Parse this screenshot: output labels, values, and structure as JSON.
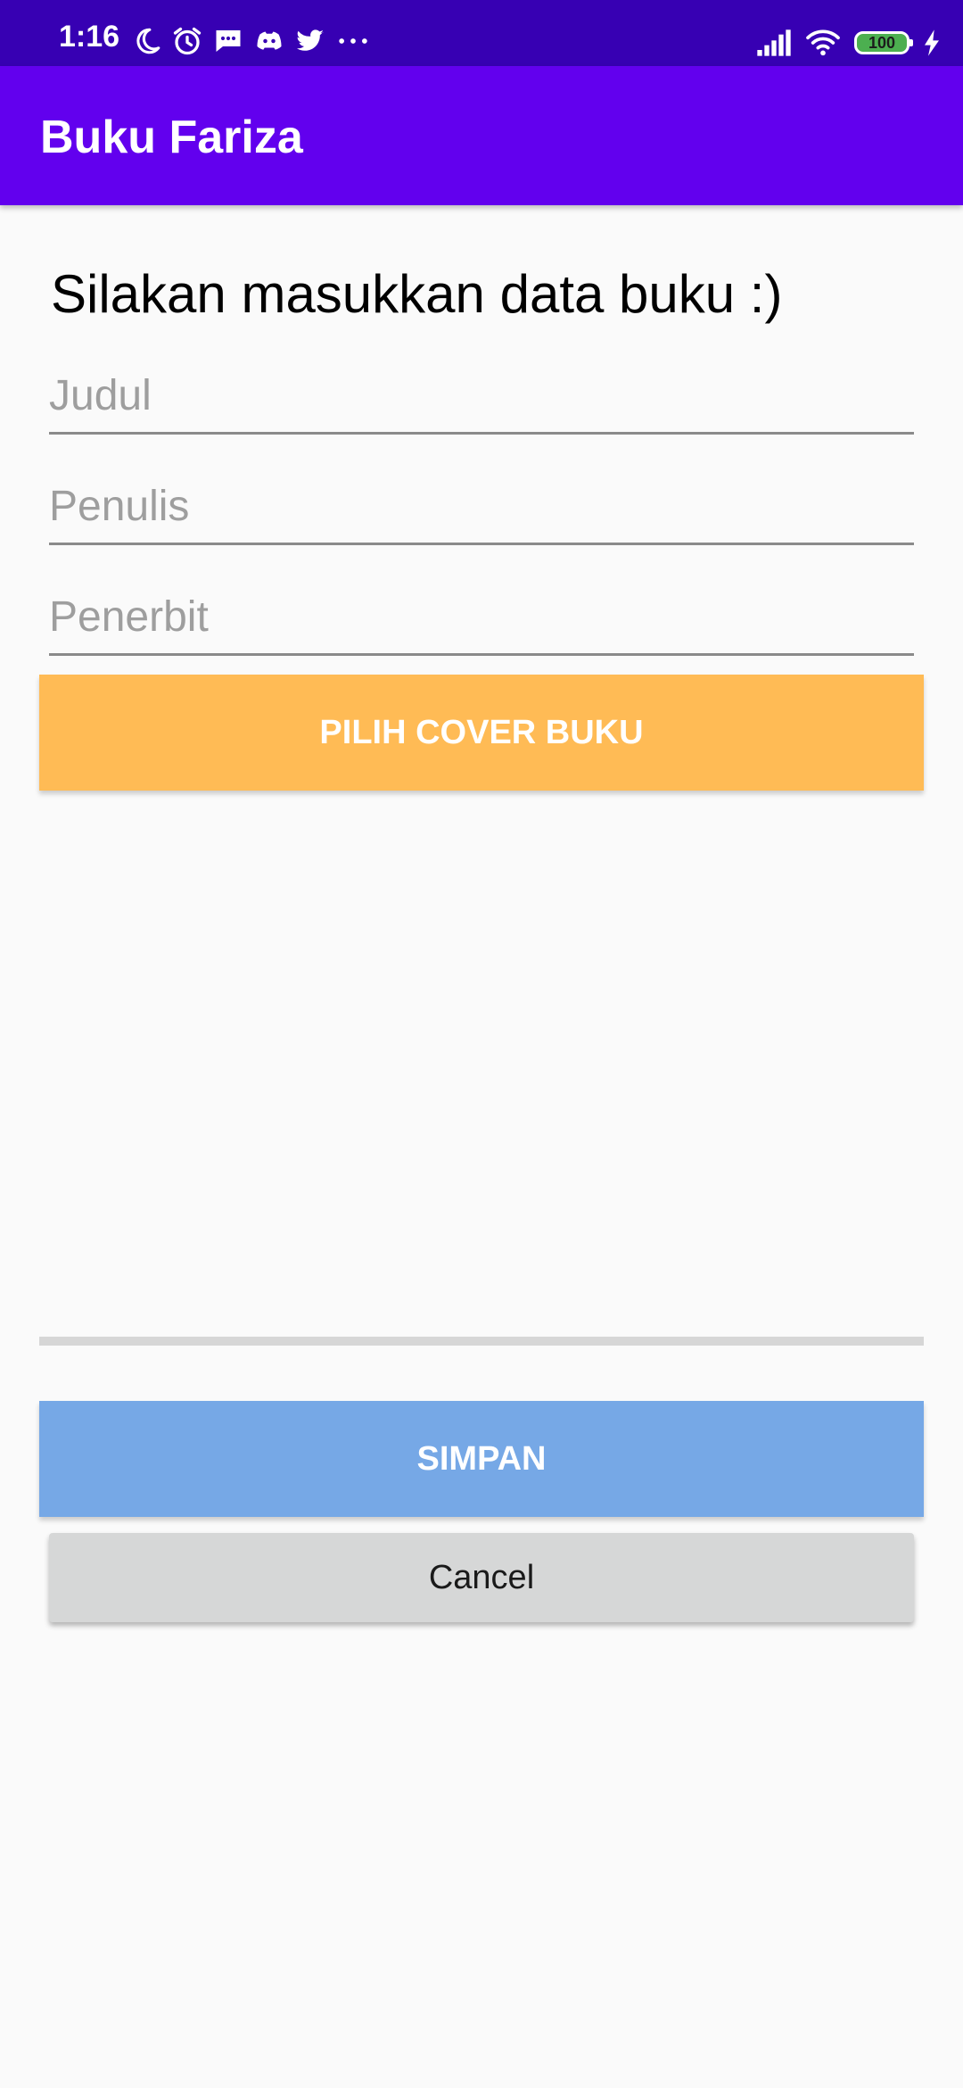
{
  "status_bar": {
    "time": "1:16",
    "left_icons": [
      "moon-icon",
      "alarm-icon",
      "message-icon",
      "discord-icon",
      "twitter-icon",
      "more-icon"
    ],
    "right_icons": [
      "signal-icon",
      "wifi-icon",
      "battery-icon",
      "charging-icon"
    ],
    "battery_level": "100",
    "background": "#3700b3"
  },
  "app_bar": {
    "title": "Buku Fariza",
    "background": "#6200ee"
  },
  "form": {
    "heading": "Silakan masukkan data buku :)",
    "title_placeholder": "Judul",
    "author_placeholder": "Penulis",
    "publisher_placeholder": "Penerbit"
  },
  "buttons": {
    "choose_cover": "PILIH COVER BUKU",
    "save": "SIMPAN",
    "cancel": "Cancel"
  },
  "colors": {
    "cover_button": "#ffbb55",
    "save_button": "#76a8e6",
    "cancel_button": "#d6d7d7"
  }
}
